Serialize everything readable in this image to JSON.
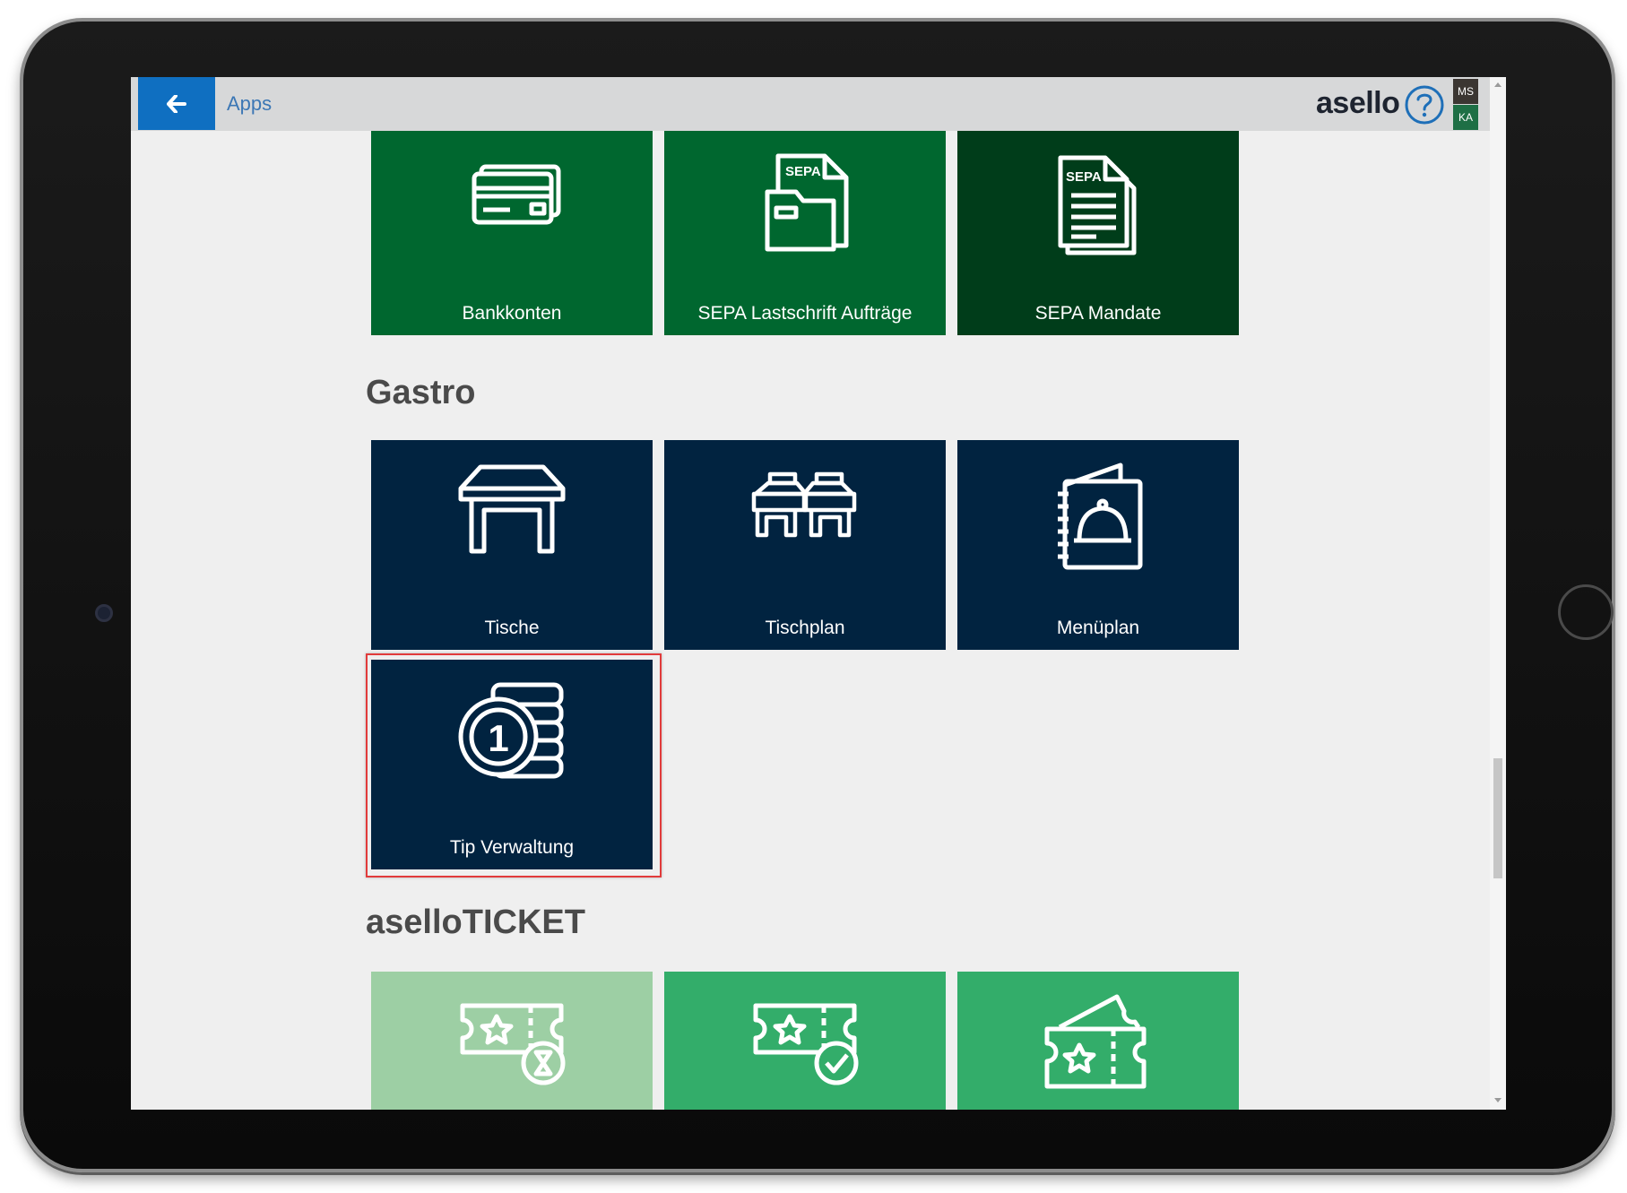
{
  "header": {
    "breadcrumb": "Apps",
    "logo": "asello",
    "user_initials_top": "MS",
    "user_initials_bottom": "KA"
  },
  "finance_tiles": [
    {
      "label": "Bankkonten",
      "icon": "credit-card-icon"
    },
    {
      "label": "SEPA Lastschrift Aufträge",
      "icon": "sepa-folder-icon"
    },
    {
      "label": "SEPA Mandate",
      "icon": "sepa-document-icon"
    }
  ],
  "sections": {
    "gastro": "Gastro",
    "ticket": "aselloTICKET"
  },
  "gastro_tiles": [
    {
      "label": "Tische",
      "icon": "table-icon"
    },
    {
      "label": "Tischplan",
      "icon": "table-plan-icon"
    },
    {
      "label": "Menüplan",
      "icon": "menu-book-icon"
    },
    {
      "label": "Tip Verwaltung",
      "icon": "coin-stack-icon",
      "highlighted": true
    }
  ],
  "ticket_tiles": [
    {
      "icon": "ticket-hourglass-icon"
    },
    {
      "icon": "ticket-check-icon"
    },
    {
      "icon": "ticket-icon"
    }
  ],
  "colors": {
    "finance_green": "#00672f",
    "finance_dark_green": "#003d1a",
    "gastro_navy": "#012340",
    "ticket_light_green": "#9dcfa4",
    "ticket_green": "#33ad6a",
    "back_button_blue": "#0f6fc1",
    "highlight_red": "#e13b3b"
  }
}
